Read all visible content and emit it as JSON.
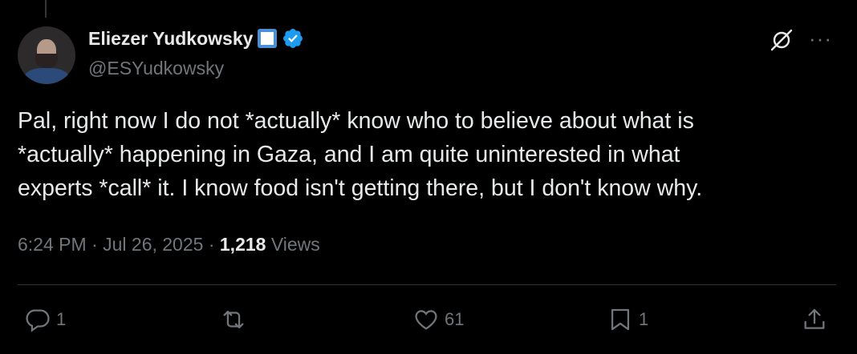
{
  "author": {
    "display_name": "Eliezer Yudkowsky",
    "handle": "@ESYudkowsky"
  },
  "tweet": {
    "text": "Pal, right now I do not *actually* know who to believe about what is\n*actually* happening in Gaza, and I am quite uninterested in what\nexperts *call* it.  I know food isn't getting there, but I don't know why.",
    "time": "6:24 PM",
    "date": "Jul 26, 2025",
    "views_count": "1,218",
    "views_label": "Views"
  },
  "actions": {
    "replies": "1",
    "retweets": "",
    "likes": "61",
    "bookmarks": "1"
  },
  "colors": {
    "background": "#000000",
    "text": "#e7e9ea",
    "muted": "#71767b",
    "verified": "#1d9bf0"
  }
}
